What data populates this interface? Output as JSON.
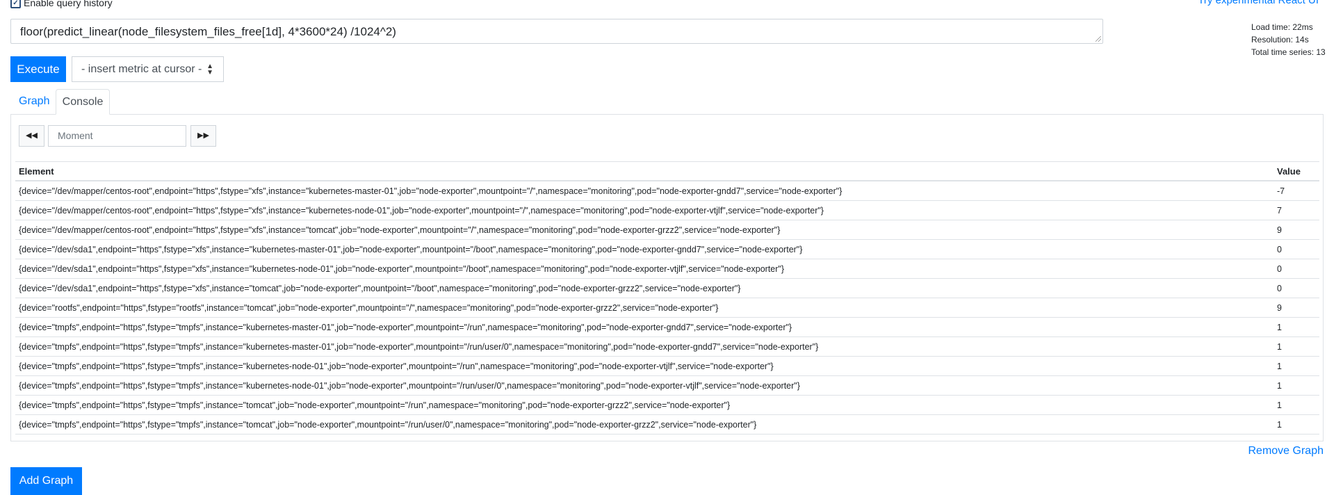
{
  "header": {
    "query_history_label": "Enable query history",
    "react_link": "Try experimental React UI"
  },
  "query": {
    "expression": "floor(predict_linear(node_filesystem_files_free[1d], 4*3600*24) /1024^2)"
  },
  "stats": {
    "load_time": "Load time: 22ms",
    "resolution": "Resolution: 14s",
    "total_series": "Total time series: 13"
  },
  "toolbar": {
    "execute_label": "Execute",
    "metric_select": "- insert metric at cursor -"
  },
  "tabs": [
    {
      "label": "Graph"
    },
    {
      "label": "Console"
    }
  ],
  "console": {
    "moment_placeholder": "Moment"
  },
  "table": {
    "headers": [
      "Element",
      "Value"
    ],
    "rows": [
      [
        "{device=\"/dev/mapper/centos-root\",endpoint=\"https\",fstype=\"xfs\",instance=\"kubernetes-master-01\",job=\"node-exporter\",mountpoint=\"/\",namespace=\"monitoring\",pod=\"node-exporter-gndd7\",service=\"node-exporter\"}",
        "-7"
      ],
      [
        "{device=\"/dev/mapper/centos-root\",endpoint=\"https\",fstype=\"xfs\",instance=\"kubernetes-node-01\",job=\"node-exporter\",mountpoint=\"/\",namespace=\"monitoring\",pod=\"node-exporter-vtjlf\",service=\"node-exporter\"}",
        "7"
      ],
      [
        "{device=\"/dev/mapper/centos-root\",endpoint=\"https\",fstype=\"xfs\",instance=\"tomcat\",job=\"node-exporter\",mountpoint=\"/\",namespace=\"monitoring\",pod=\"node-exporter-grzz2\",service=\"node-exporter\"}",
        "9"
      ],
      [
        "{device=\"/dev/sda1\",endpoint=\"https\",fstype=\"xfs\",instance=\"kubernetes-master-01\",job=\"node-exporter\",mountpoint=\"/boot\",namespace=\"monitoring\",pod=\"node-exporter-gndd7\",service=\"node-exporter\"}",
        "0"
      ],
      [
        "{device=\"/dev/sda1\",endpoint=\"https\",fstype=\"xfs\",instance=\"kubernetes-node-01\",job=\"node-exporter\",mountpoint=\"/boot\",namespace=\"monitoring\",pod=\"node-exporter-vtjlf\",service=\"node-exporter\"}",
        "0"
      ],
      [
        "{device=\"/dev/sda1\",endpoint=\"https\",fstype=\"xfs\",instance=\"tomcat\",job=\"node-exporter\",mountpoint=\"/boot\",namespace=\"monitoring\",pod=\"node-exporter-grzz2\",service=\"node-exporter\"}",
        "0"
      ],
      [
        "{device=\"rootfs\",endpoint=\"https\",fstype=\"rootfs\",instance=\"tomcat\",job=\"node-exporter\",mountpoint=\"/\",namespace=\"monitoring\",pod=\"node-exporter-grzz2\",service=\"node-exporter\"}",
        "9"
      ],
      [
        "{device=\"tmpfs\",endpoint=\"https\",fstype=\"tmpfs\",instance=\"kubernetes-master-01\",job=\"node-exporter\",mountpoint=\"/run\",namespace=\"monitoring\",pod=\"node-exporter-gndd7\",service=\"node-exporter\"}",
        "1"
      ],
      [
        "{device=\"tmpfs\",endpoint=\"https\",fstype=\"tmpfs\",instance=\"kubernetes-master-01\",job=\"node-exporter\",mountpoint=\"/run/user/0\",namespace=\"monitoring\",pod=\"node-exporter-gndd7\",service=\"node-exporter\"}",
        "1"
      ],
      [
        "{device=\"tmpfs\",endpoint=\"https\",fstype=\"tmpfs\",instance=\"kubernetes-node-01\",job=\"node-exporter\",mountpoint=\"/run\",namespace=\"monitoring\",pod=\"node-exporter-vtjlf\",service=\"node-exporter\"}",
        "1"
      ],
      [
        "{device=\"tmpfs\",endpoint=\"https\",fstype=\"tmpfs\",instance=\"kubernetes-node-01\",job=\"node-exporter\",mountpoint=\"/run/user/0\",namespace=\"monitoring\",pod=\"node-exporter-vtjlf\",service=\"node-exporter\"}",
        "1"
      ],
      [
        "{device=\"tmpfs\",endpoint=\"https\",fstype=\"tmpfs\",instance=\"tomcat\",job=\"node-exporter\",mountpoint=\"/run\",namespace=\"monitoring\",pod=\"node-exporter-grzz2\",service=\"node-exporter\"}",
        "1"
      ],
      [
        "{device=\"tmpfs\",endpoint=\"https\",fstype=\"tmpfs\",instance=\"tomcat\",job=\"node-exporter\",mountpoint=\"/run/user/0\",namespace=\"monitoring\",pod=\"node-exporter-grzz2\",service=\"node-exporter\"}",
        "1"
      ]
    ]
  },
  "footer": {
    "remove_graph": "Remove Graph",
    "add_graph": "Add Graph"
  },
  "colors": {
    "primary": "#007bff",
    "border": "#dee2e6"
  }
}
